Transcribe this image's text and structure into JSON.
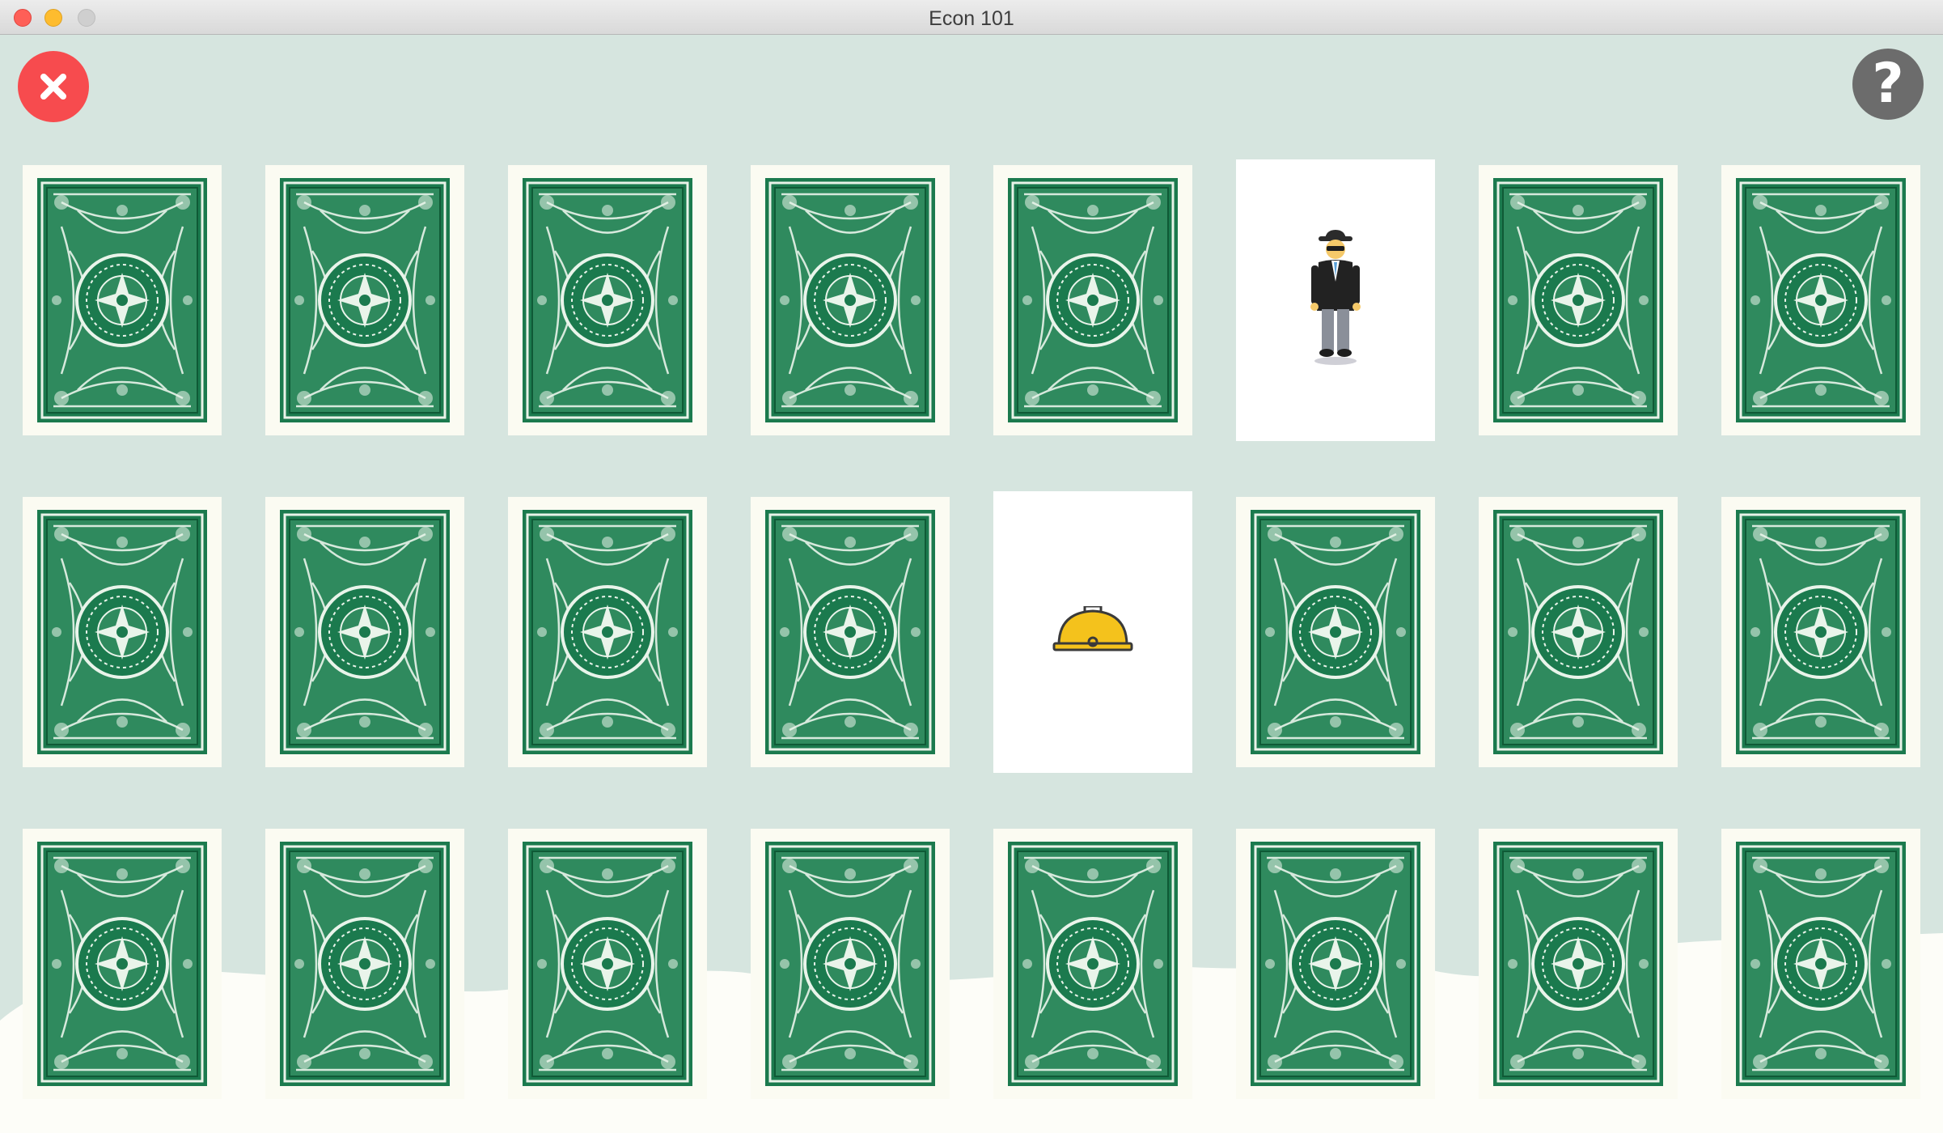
{
  "window": {
    "title": "Econ 101"
  },
  "toolbar": {
    "close_icon": "close-icon",
    "help_icon": "question-mark-icon",
    "help_label": "?"
  },
  "board": {
    "rows": 3,
    "columns": 8,
    "card_back_color": "#1b7a4e",
    "cards": [
      {
        "state": "face-down"
      },
      {
        "state": "face-down"
      },
      {
        "state": "face-down"
      },
      {
        "state": "face-down"
      },
      {
        "state": "face-down"
      },
      {
        "state": "face-up",
        "icon": "businessman-icon"
      },
      {
        "state": "face-down"
      },
      {
        "state": "face-down"
      },
      {
        "state": "face-down"
      },
      {
        "state": "face-down"
      },
      {
        "state": "face-down"
      },
      {
        "state": "face-down"
      },
      {
        "state": "face-up",
        "icon": "hard-hat-icon"
      },
      {
        "state": "face-down"
      },
      {
        "state": "face-down"
      },
      {
        "state": "face-down"
      },
      {
        "state": "face-down"
      },
      {
        "state": "face-down"
      },
      {
        "state": "face-down"
      },
      {
        "state": "face-down"
      },
      {
        "state": "face-down"
      },
      {
        "state": "face-down"
      },
      {
        "state": "face-down"
      },
      {
        "state": "face-down"
      }
    ]
  }
}
